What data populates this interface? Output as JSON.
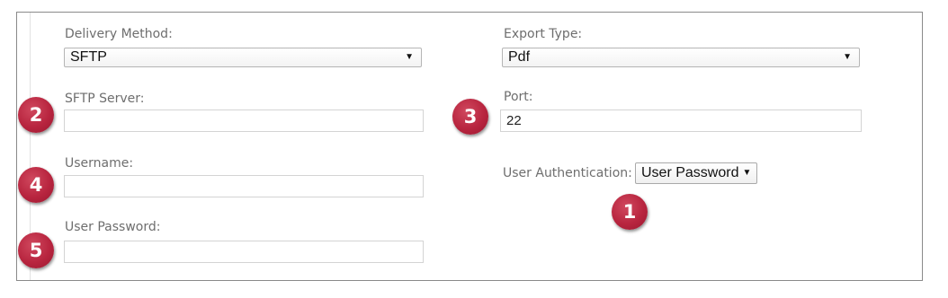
{
  "form": {
    "delivery_method": {
      "label": "Delivery Method:",
      "value": "SFTP"
    },
    "export_type": {
      "label": "Export Type:",
      "value": "Pdf"
    },
    "sftp_server": {
      "label": "SFTP Server:",
      "value": ""
    },
    "port": {
      "label": "Port:",
      "value": "22"
    },
    "username": {
      "label": "Username:",
      "value": ""
    },
    "user_authentication": {
      "label": "User Authentication:",
      "value": "User Password"
    },
    "user_password": {
      "label": "User Password:",
      "value": ""
    }
  },
  "arrow_glyph": "▼",
  "callouts": {
    "one": "1",
    "two": "2",
    "three": "3",
    "four": "4",
    "five": "5"
  },
  "colors": {
    "callout_red": "#b8253f",
    "frame_border": "#8a8a8a",
    "label_gray": "#6e6e6e"
  }
}
